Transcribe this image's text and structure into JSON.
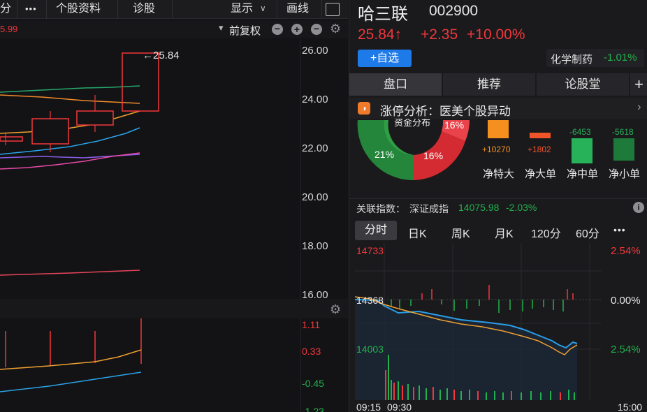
{
  "toolbar": {
    "frag": "分",
    "more": "•••",
    "profile": "个股资料",
    "diagnose": "诊股",
    "display": "显示",
    "draw": "画线"
  },
  "kline": {
    "ma_frag": "5.99",
    "adjust": "前复权",
    "price_ticks": [
      "26.00",
      "24.00",
      "22.00",
      "20.00",
      "18.00",
      "16.00"
    ],
    "last_label": "←25.84",
    "vol_ticks": [
      "1.11",
      "0.33",
      "-0.45",
      "-1.23"
    ]
  },
  "stock": {
    "name": "哈三联",
    "code": "002900",
    "price": "25.84↑",
    "change": "+2.35",
    "pct": "+10.00%",
    "watch": "+自选",
    "sector": "化学制药",
    "sector_pct": "-1.01%"
  },
  "tabs": {
    "t1": "盘口",
    "t2": "推荐",
    "t3": "论股堂",
    "plus": "+"
  },
  "banner": {
    "text": "涨停分析：医美个股异动"
  },
  "fund": {
    "donut_title": "资金分布",
    "pct_a": "16%",
    "pct_b": "16%",
    "pct_c": "21%",
    "bars": [
      {
        "label": "净特大",
        "value": "+10270",
        "color": "#f59020"
      },
      {
        "label": "净大单",
        "value": "+1802",
        "color": "#f0552a"
      },
      {
        "label": "净中单",
        "value": "-6453",
        "color": "#27b25a"
      },
      {
        "label": "净小单",
        "value": "-5618",
        "color": "#1e7a3a"
      }
    ]
  },
  "index": {
    "label": "关联指数：",
    "name": "深证成指",
    "value": "14075.98",
    "pct": "-2.03%"
  },
  "period_tabs": [
    "分时",
    "日K",
    "周K",
    "月K",
    "120分",
    "60分",
    "•••"
  ],
  "intraday": {
    "hi": "14733",
    "mid": "14368",
    "lo": "14003",
    "pct_hi": "2.54%",
    "pct_mid": "0.00%",
    "pct_lo": "2.54%",
    "t0": "09:15",
    "t1": "09:30",
    "t2": "15:00"
  },
  "colors": {
    "up": "#f2373b",
    "down": "#22b14c",
    "accent": "#1e7ae8"
  }
}
